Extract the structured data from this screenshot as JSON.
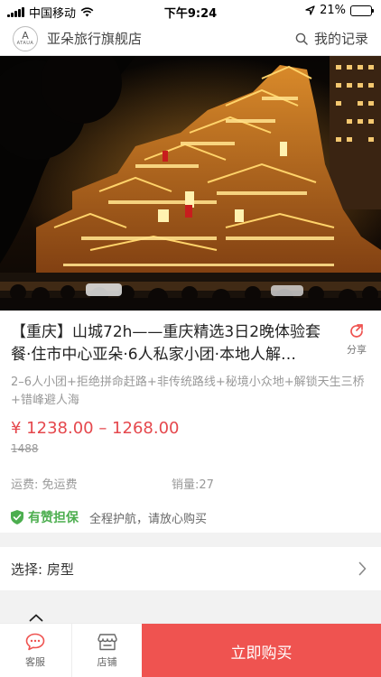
{
  "status_bar": {
    "carrier": "中国移动",
    "time": "下午9:24",
    "battery_percent": "21%",
    "battery_level": 0.21
  },
  "store": {
    "logo_mark": "A",
    "logo_text": "ATAUA",
    "name": "亚朵旅行旗舰店",
    "records_label": "我的记录"
  },
  "product": {
    "title": "【重庆】山城72h——重庆精选3日2晚体验套餐·住市中心亚朵·6人私家小团·本地人解…",
    "share_label": "分享",
    "subtitle": "2–6人小团+拒绝拼命赶路+非传统路线+秘境小众地+解锁天生三桥+错峰避人海",
    "price": "¥ 1238.00 – 1268.00",
    "original_price": "1488",
    "shipping": "运费: 免运费",
    "sales": "销量:27",
    "guarantee_title": "有赞担保",
    "guarantee_desc": "全程护航，请放心购买"
  },
  "select": {
    "label": "选择: 房型"
  },
  "bottom_bar": {
    "service_label": "客服",
    "store_label": "店铺",
    "buy_label": "立即购买"
  },
  "colors": {
    "accent_red": "#ef5350",
    "price_red": "#e5484d",
    "guarantee_green": "#4cae4f"
  }
}
